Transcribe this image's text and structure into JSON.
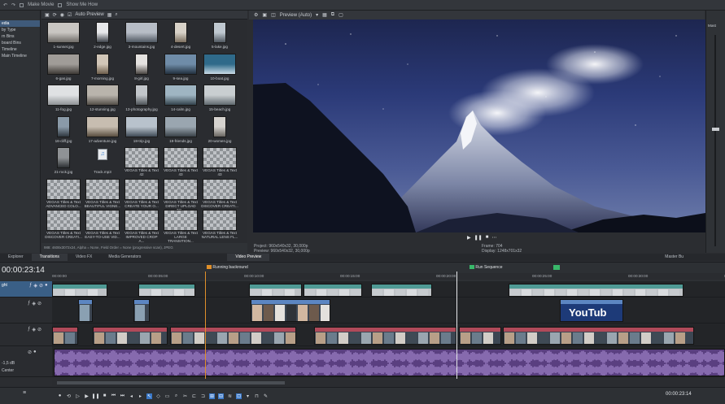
{
  "menu": {
    "make_movie": "Make Movie",
    "show_me_how": "Show Me How"
  },
  "tree": {
    "items": [
      "edia",
      "by Type",
      "rn Bins",
      "board Bins",
      "Timeline",
      "Main Timeline"
    ]
  },
  "media_toolbar": {
    "auto_preview": "Auto Preview"
  },
  "media": {
    "items": [
      "1-sunset.jpg",
      "2-edge.jpg",
      "3-mountains.jpg",
      "4-desert.jpg",
      "5-lake.jpg",
      "6-gas.jpg",
      "7-morning.jpg",
      "8-girl.jpg",
      "9-sea.jpg",
      "10-boat.jpg",
      "11-fog.jpg",
      "12-stunning.jpg",
      "13-photography.jpg",
      "14-calm.jpg",
      "15-beach.jpg",
      "16-cliff.jpg",
      "17-adventure.jpg",
      "18-trip.jpg",
      "19-friends.jpg",
      "20-women.jpg",
      "21-rock.jpg",
      "Track.mp3",
      "VEGAS Titles & Text 42",
      "VEGAS Titles & Text 43",
      "VEGAS Titles & Text 43",
      "VEGAS Titles & Text ADVANCED COLO...",
      "VEGAS Titles & Text BEAUTIFUL VIGNE...",
      "VEGAS Titles & Text CREATE YOUR O...",
      "VEGAS Titles & Text DIRECT UPLOAD TO...",
      "VEGAS Titles & Text DISCOVER CREATI...",
      "VEGAS Titles & Text DISCOVER CREATI...",
      "VEGAS Titles & Text EASY-TO-USE VID...",
      "VEGAS Titles & Text IMPROVED CROP A...",
      "VEGAS Titles & Text LARGE TRANSITION...",
      "VEGAS Titles & Text NATURAL LENS FL..."
    ],
    "status": "988: 4608x3072x24, Alpha = None, Field Order = None (progressive scan), JPEG"
  },
  "preview": {
    "mode": "Preview (Auto)",
    "project": "Project:  960x540x32, 30,000p",
    "preview": "Preview: 960x540x32, 30,000p",
    "frame": "Frame:    704",
    "display": "Display:  1248x701x32"
  },
  "master": {
    "label": "Mast"
  },
  "tabs": [
    "Explorer",
    "Transitions",
    "Video FX",
    "Media Generators",
    "Video Preview",
    "Master Bu"
  ],
  "timeline": {
    "timecode": "00:00:23:14",
    "ruler": [
      "00:00:00",
      "00:00:05:00",
      "00:00:10:00",
      "00:00:15:00",
      "00:00:20:00",
      "00:00:25:00",
      "00:00:30:00",
      "00:00:35:00"
    ],
    "markers": [
      "Running backround",
      "Run Sequence"
    ],
    "track_volume": "-1,5 dB",
    "track_pan": "Center",
    "title_clip": "YouTub",
    "clip_labels": [
      "Sunset",
      "Cliff",
      "Beach",
      "Easy"
    ],
    "transport_time": "00:00:23:14"
  },
  "colors": {
    "video_clip": "#4f9a95",
    "photo_clip": "#b04a5a",
    "audio_clip": "#6f4c9c",
    "accent": "#3a78c8"
  }
}
